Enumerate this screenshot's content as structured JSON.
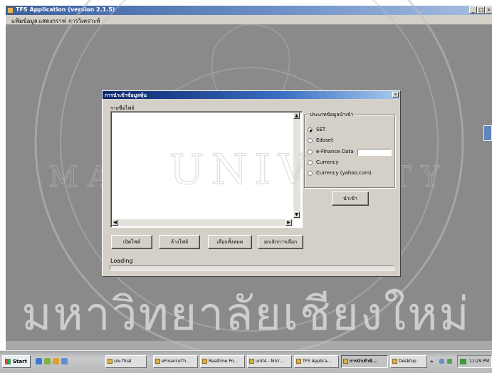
{
  "app": {
    "title": "TFS Application (version 2.1.5)",
    "window_controls": [
      "_",
      "□",
      "×"
    ]
  },
  "menu": {
    "items": [
      "แฟ้มข้อมูล",
      "แสดงกราฟ",
      "การวิเคราะห์"
    ]
  },
  "dialog": {
    "title": "การนำเข้าข้อมูลหุ้น",
    "file_list_label": "รายชื่อไฟล์",
    "group_label": "ประเภทข้อมูลนำเข้า",
    "options": [
      "SET",
      "Edoset",
      "e-Finance Data",
      "Currency",
      "Currency (yahoo.com)"
    ],
    "selected_option": "SET",
    "import_button": "นำเข้า",
    "buttons": [
      "เปิดไฟล์",
      "ล้างไฟล์",
      "เลือกทั้งหมด",
      "ยกเลิกการเลือก"
    ],
    "status_text": "Loading",
    "progress": 0
  },
  "taskbar": {
    "start_label": "Start",
    "items": [
      "เล่ม final",
      "eFinanceTh...",
      "Realtime Po...",
      "unit4 - Micr...",
      "TFS Applica...",
      "การนำเข้าข้...",
      "Desktop"
    ],
    "active_item": "การนำเข้าข้...",
    "clock": "11:29 PM"
  },
  "watermark": {
    "thai_text": "มหาวิทยาลัยเชียงใหม่",
    "arc_text": "MAI UNIVERSITY",
    "center_text": "UNIV"
  }
}
